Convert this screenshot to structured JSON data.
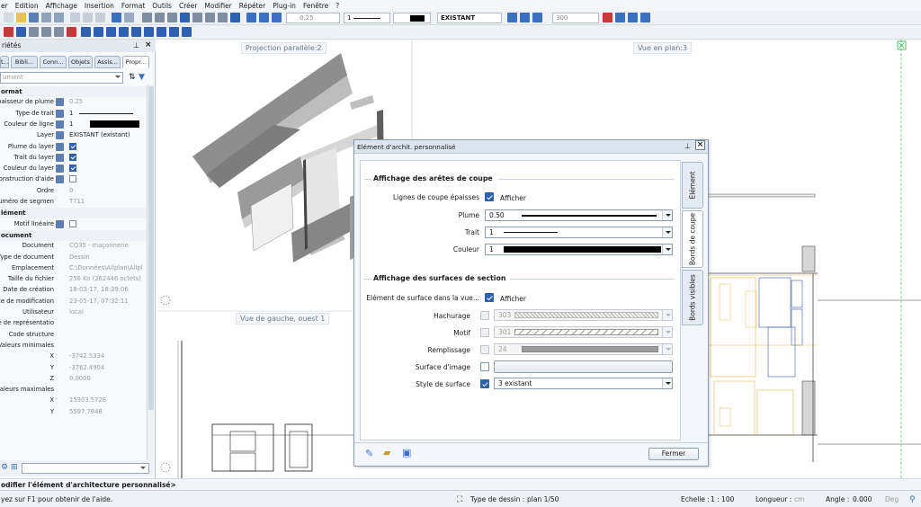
{
  "menu": [
    "er",
    "Edition",
    "Affichage",
    "Insertion",
    "Format",
    "Outils",
    "Créer",
    "Modifier",
    "Répéter",
    "Plug-in",
    "Fenêtre",
    "?"
  ],
  "toolbar": {
    "pen_value": "0.25",
    "pen_field": "1",
    "layer_value": "EXISTANT",
    "scale_value": "300"
  },
  "palette": {
    "title": "riétés",
    "tabs": [
      "t...",
      "Bibli...",
      "Conn...",
      "Objets",
      "Assis...",
      "Propr..."
    ],
    "combo": "ument",
    "section_format": "ormat",
    "rows_format": [
      {
        "label": "paisseur de plume",
        "value": "0.25",
        "grey": true
      },
      {
        "label": "Type de trait",
        "value": "1"
      },
      {
        "label": "Couleur de ligne",
        "value": "1"
      },
      {
        "label": "Layer",
        "value": "EXISTANT (existant)"
      },
      {
        "label": "Plume du layer",
        "value": ""
      },
      {
        "label": "Trait du layer",
        "value": ""
      },
      {
        "label": "Couleur du layer",
        "value": ""
      },
      {
        "label": "onstruction d'aide",
        "value": ""
      },
      {
        "label": "Ordre",
        "value": "0",
        "grey": true
      },
      {
        "label": "uméro de segmen",
        "value": "T711",
        "grey": true
      }
    ],
    "section_element": "lément",
    "rows_element": [
      {
        "label": "Motif linéaire",
        "value": ""
      }
    ],
    "section_document": "ocument",
    "rows_document": [
      {
        "label": "Document",
        "value": "CQ35 - maçonnerie",
        "grey": true
      },
      {
        "label": "Type de document",
        "value": "Dessin",
        "grey": true
      },
      {
        "label": "Emplacement",
        "value": "C:\\Données\\Allplan\\Allpl",
        "grey": true
      },
      {
        "label": "Taille du fichier",
        "value": "256 Ko (262446 octets)",
        "grey": true
      },
      {
        "label": "Date de création",
        "value": "18-03-17, 18:39:06",
        "grey": true
      },
      {
        "label": "Date de modification",
        "value": "23-05-17, 07:32:11",
        "grey": true
      },
      {
        "label": "Utilisateur",
        "value": "local",
        "grey": true
      },
      {
        "label": "ode de représentatio",
        "value": ""
      },
      {
        "label": "Code structure",
        "value": ""
      },
      {
        "label": "Valeurs minimales",
        "value": ""
      },
      {
        "label": "X",
        "value": "-3742.5334",
        "grey": true
      },
      {
        "label": "Y",
        "value": "-3762.4904",
        "grey": true
      },
      {
        "label": "Z",
        "value": "0.0000",
        "grey": true
      },
      {
        "label": "Valeurs maximales",
        "value": ""
      },
      {
        "label": "X",
        "value": "15303.5728",
        "grey": true
      },
      {
        "label": "Y",
        "value": "5597.7848",
        "grey": true
      }
    ]
  },
  "viewports": {
    "proj": "Projection parallèle:2",
    "plan": "Vue en plan:3",
    "left": "Vue de gauche, ouest 1"
  },
  "dialog": {
    "title": "Elément d'archit. personnalisé",
    "section1": "Affichage des arêtes de coupe",
    "lignes_label": "Lignes de coupe épaisses",
    "lignes_check": "Afficher",
    "plume_label": "Plume",
    "plume_value": "0.50",
    "trait_label": "Trait",
    "trait_value": "1",
    "couleur_label": "Couleur",
    "couleur_value": "1",
    "section2": "Affichage des surfaces de section",
    "surface_label": "Elément de surface dans la vue...",
    "surface_check": "Afficher",
    "hachurage_label": "Hachurage",
    "hachurage_value": "303",
    "motif_label": "Motif",
    "motif_value": "301",
    "remplissage_label": "Remplissage",
    "remplissage_value": "24",
    "image_label": "Surface d'image",
    "style_label": "Style de surface",
    "style_value": "3 existant",
    "tabs": [
      "Elément",
      "Bords de coupe",
      "Bords visibles"
    ],
    "close_btn": "Fermer"
  },
  "statusline": "odifier l'élément d'architecture personnalisé>",
  "status": {
    "help": "yez sur F1 pour obtenir de l'aide.",
    "type_label": "Type de dessin :",
    "type_value": "plan 1/50",
    "echelle_label": "Echelle :",
    "echelle_value": "1 : 100",
    "longueur_label": "Longueur :",
    "longueur_value": "cm",
    "angle_label": "Angle :",
    "angle_value": "0.000",
    "deg": "Deg"
  },
  "colors": {
    "accent": "#2f61b0",
    "yellow_lines": "#e0b84a",
    "blue_lines": "#3a55b0"
  }
}
